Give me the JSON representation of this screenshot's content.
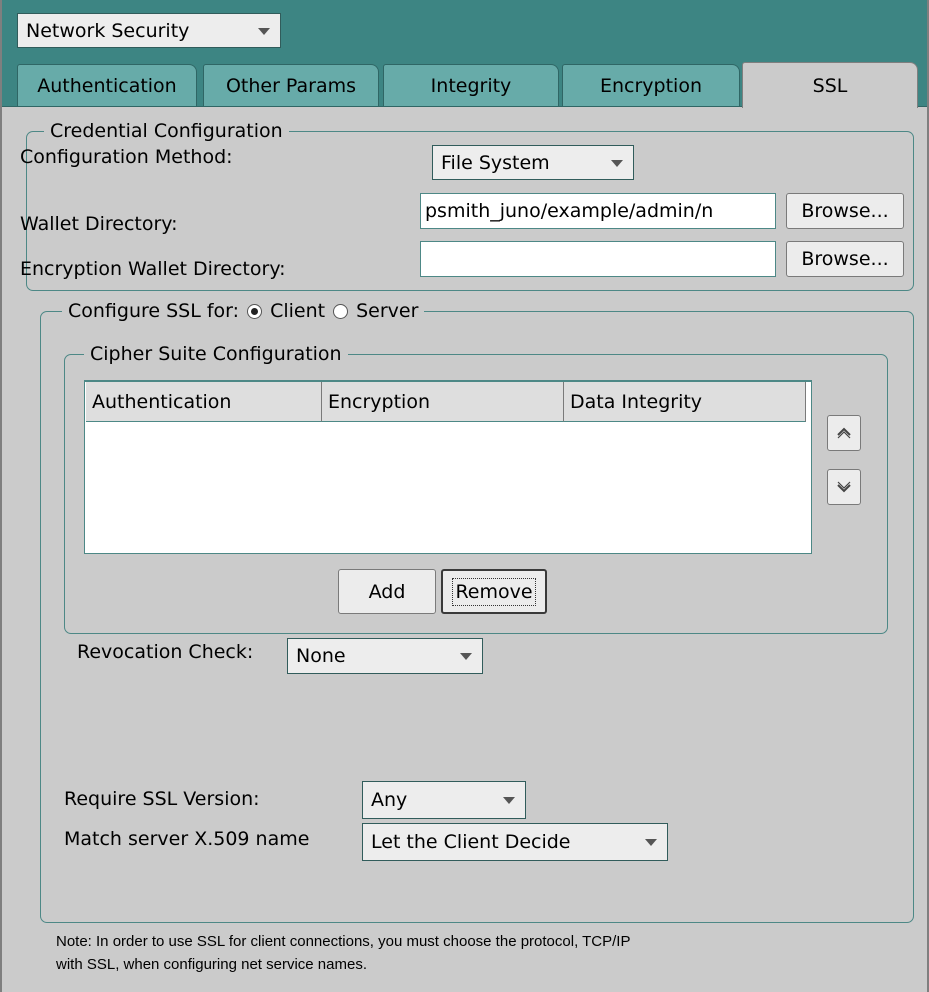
{
  "header": {
    "category_select": "Network Security"
  },
  "tabs": [
    {
      "label": "Authentication",
      "active": false
    },
    {
      "label": "Other Params",
      "active": false
    },
    {
      "label": "Integrity",
      "active": false
    },
    {
      "label": "Encryption",
      "active": false
    },
    {
      "label": "SSL",
      "active": true
    }
  ],
  "credential_group": {
    "title": "Credential Configuration",
    "method_label": "Configuration Method:",
    "method_value": "File System",
    "wallet_label": "Wallet Directory:",
    "wallet_value": "psmith_juno/example/admin/n",
    "wallet_browse": "Browse...",
    "enc_wallet_label": "Encryption Wallet Directory:",
    "enc_wallet_value": "",
    "enc_wallet_browse": "Browse..."
  },
  "ssl_group": {
    "title": "Configure SSL for:",
    "client_label": "Client",
    "server_label": "Server",
    "selected": "Client"
  },
  "cipher_group": {
    "title": "Cipher Suite Configuration",
    "columns": [
      "Authentication",
      "Encryption",
      "Data Integrity"
    ],
    "rows": [],
    "add_label": "Add",
    "remove_label": "Remove",
    "move_up_icon": "chevron-up-icon",
    "move_down_icon": "chevron-down-icon"
  },
  "revocation": {
    "label": "Revocation Check:",
    "value": "None"
  },
  "ssl_version": {
    "label": "Require SSL Version:",
    "value": "Any"
  },
  "match_server": {
    "label": "Match server X.509 name",
    "value": "Let the Client Decide"
  },
  "note": {
    "line1": "Note: In order to use SSL for client connections, you must choose the protocol, TCP/IP",
    "line2": "with SSL, when configuring net service names."
  },
  "colors": {
    "header_teal": "#3d8583",
    "tab_teal": "#67aba9",
    "panel_gray": "#cbcbcb",
    "border_teal": "#4d8886"
  }
}
